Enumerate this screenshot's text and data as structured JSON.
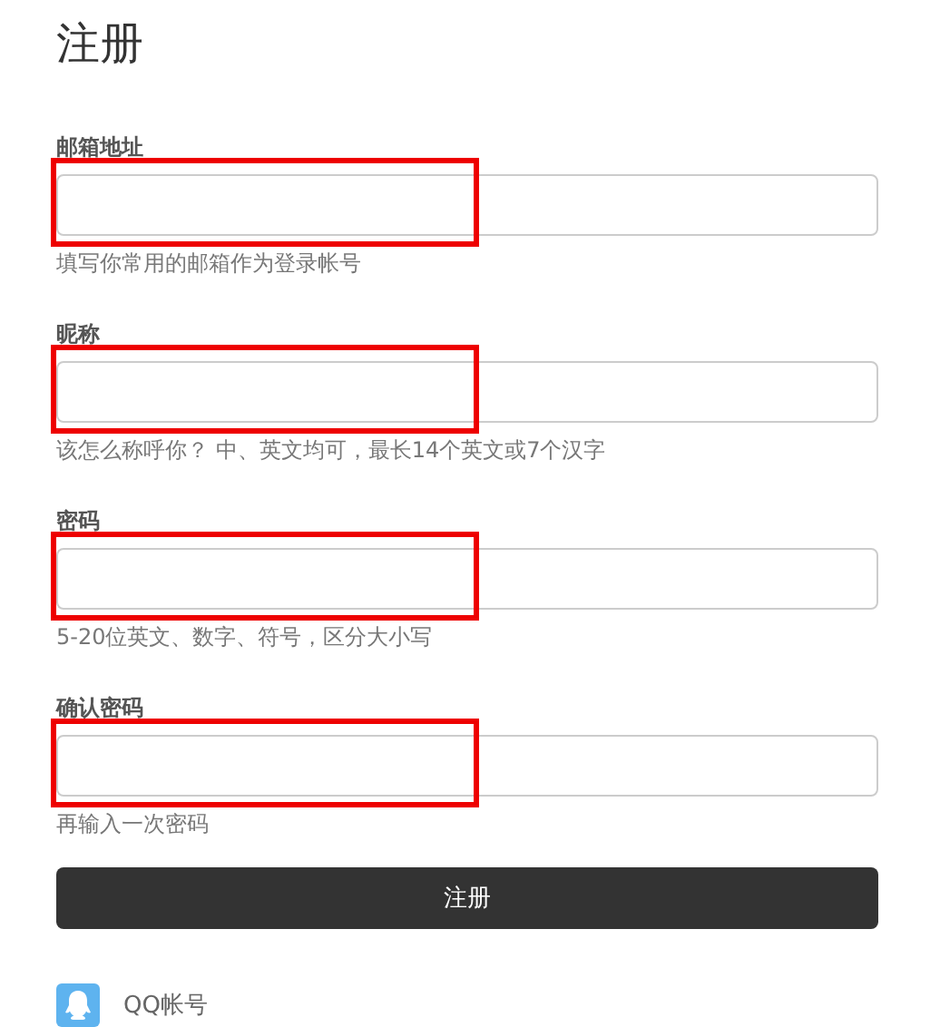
{
  "title": "注册",
  "fields": [
    {
      "label": "邮箱地址",
      "hint": "填写你常用的邮箱作为登录帐号",
      "highlighted": true
    },
    {
      "label": "昵称",
      "hint": "该怎么称呼你？ 中、英文均可，最长14个英文或7个汉字",
      "highlighted": true
    },
    {
      "label": "密码",
      "hint": "5-20位英文、数字、符号，区分大小写",
      "highlighted": true
    },
    {
      "label": "确认密码",
      "hint": "再输入一次密码",
      "highlighted": true
    }
  ],
  "submit": "注册",
  "social": [
    {
      "label": "QQ帐号"
    }
  ]
}
